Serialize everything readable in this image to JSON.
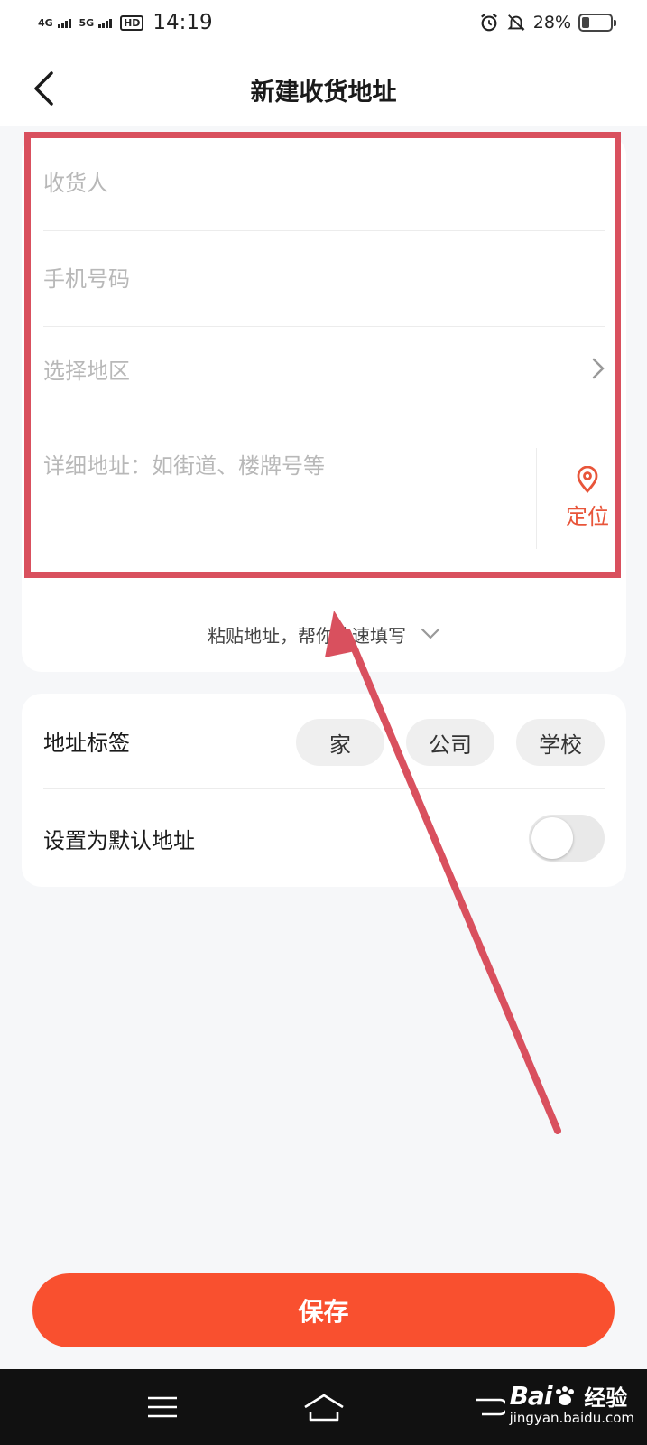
{
  "status_bar": {
    "network_1": "4G",
    "network_2": "5G",
    "hd": "HD",
    "time": "14:19",
    "battery_percent": "28%",
    "battery_level": 0.28
  },
  "header": {
    "title": "新建收货地址"
  },
  "form": {
    "recipient_placeholder": "收货人",
    "phone_placeholder": "手机号码",
    "region_placeholder": "选择地区",
    "detail_placeholder": "详细地址：如街道、楼牌号等",
    "locate_label": "定位",
    "paste_label": "粘贴地址，帮你快速填写"
  },
  "tags": {
    "label": "地址标签",
    "options": [
      "家",
      "公司",
      "学校"
    ]
  },
  "default_address": {
    "label": "设置为默认地址",
    "enabled": false
  },
  "save_button": {
    "label": "保存"
  },
  "watermark": {
    "logo": "Bai",
    "brand": "经验",
    "url": "jingyan.baidu.com"
  },
  "colors": {
    "accent": "#f9502f",
    "locate": "#e8553a",
    "annotation": "#d9505e",
    "background": "#f6f7f9"
  }
}
